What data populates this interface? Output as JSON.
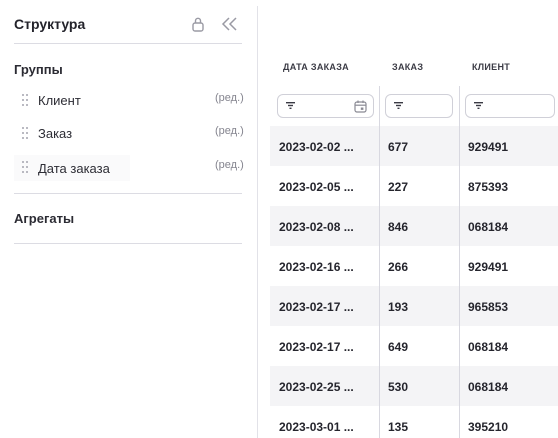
{
  "panel": {
    "title": "Структура",
    "groups_title": "Группы",
    "groups": [
      {
        "label": "Клиент",
        "edit": "(ред.)"
      },
      {
        "label": "Заказ",
        "edit": "(ред.)"
      },
      {
        "label": "Дата заказа",
        "edit": "(ред.)"
      }
    ],
    "aggregates_title": "Агрегаты"
  },
  "table": {
    "columns": [
      "ДАТА ЗАКАЗА",
      "ЗАКАЗ",
      "КЛИЕНТ"
    ],
    "rows": [
      [
        "2023-02-02 ...",
        "677",
        "929491"
      ],
      [
        "2023-02-05 ...",
        "227",
        "875393"
      ],
      [
        "2023-02-08 ...",
        "846",
        "068184"
      ],
      [
        "2023-02-16 ...",
        "266",
        "929491"
      ],
      [
        "2023-02-17 ...",
        "193",
        "965853"
      ],
      [
        "2023-02-17 ...",
        "649",
        "068184"
      ],
      [
        "2023-02-25 ...",
        "530",
        "068184"
      ],
      [
        "2023-03-01 ...",
        "135",
        "395210"
      ]
    ]
  },
  "colors": {
    "row_stripe": "#f4f4f6",
    "border": "#d0d0d8",
    "text": "#25252d"
  }
}
